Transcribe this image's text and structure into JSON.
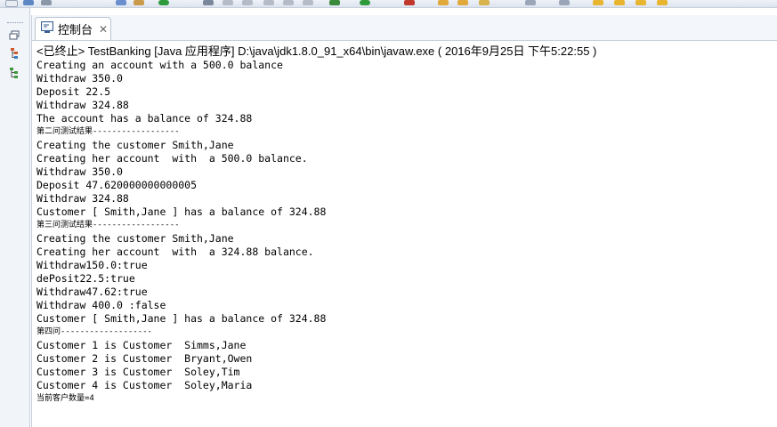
{
  "toolbar": {
    "buttons": [
      "new-icon",
      "save-icon",
      "print-icon",
      "search-icon",
      "home-icon",
      "run-icon",
      "debug-icon",
      "stop-icon",
      "skip-icon",
      "step-icon",
      "build-icon",
      "ok-icon",
      "error-icon",
      "open-folder-icon",
      "open-folder-icon",
      "new-class-icon",
      "nav-icon",
      "back-icon",
      "forward-icon"
    ]
  },
  "sidebar": {
    "icons": [
      "restore-icon",
      "outline-icon",
      "hierarchy-icon"
    ]
  },
  "console": {
    "tab_label": "控制台",
    "tab_close": "✕",
    "status": "<已终止> TestBanking [Java 应用程序] D:\\java\\jdk1.8.0_91_x64\\bin\\javaw.exe ( 2016年9月25日 下午5:22:55 )",
    "lines": [
      {
        "text": "Creating an account with a 500.0 balance",
        "small": false
      },
      {
        "text": "Withdraw 350.0",
        "small": false
      },
      {
        "text": "Deposit 22.5",
        "small": false
      },
      {
        "text": "Withdraw 324.88",
        "small": false
      },
      {
        "text": "The account has a balance of 324.88",
        "small": false
      },
      {
        "text": "第二问测试结果------------------",
        "small": true
      },
      {
        "text": "Creating the customer Smith,Jane",
        "small": false
      },
      {
        "text": "Creating her account  with  a 500.0 balance.",
        "small": false
      },
      {
        "text": "Withdraw 350.0",
        "small": false
      },
      {
        "text": "Deposit 47.620000000000005",
        "small": false
      },
      {
        "text": "Withdraw 324.88",
        "small": false
      },
      {
        "text": "Customer [ Smith,Jane ] has a balance of 324.88",
        "small": false
      },
      {
        "text": "第三问测试结果------------------",
        "small": true
      },
      {
        "text": "Creating the customer Smith,Jane",
        "small": false
      },
      {
        "text": "Creating her account  with  a 324.88 balance.",
        "small": false
      },
      {
        "text": "Withdraw150.0:true",
        "small": false
      },
      {
        "text": "dePosit22.5:true",
        "small": false
      },
      {
        "text": "Withdraw47.62:true",
        "small": false
      },
      {
        "text": "Withdraw 400.0 :false",
        "small": false
      },
      {
        "text": "Customer [ Smith,Jane ] has a balance of 324.88",
        "small": false
      },
      {
        "text": "第四问-------------------",
        "small": true
      },
      {
        "text": "Customer 1 is Customer  Simms,Jane",
        "small": false
      },
      {
        "text": "Customer 2 is Customer  Bryant,Owen",
        "small": false
      },
      {
        "text": "Customer 3 is Customer  Soley,Tim",
        "small": false
      },
      {
        "text": "Customer 4 is Customer  Soley,Maria",
        "small": false
      },
      {
        "text": "当前客户数量=4",
        "small": true
      }
    ]
  }
}
